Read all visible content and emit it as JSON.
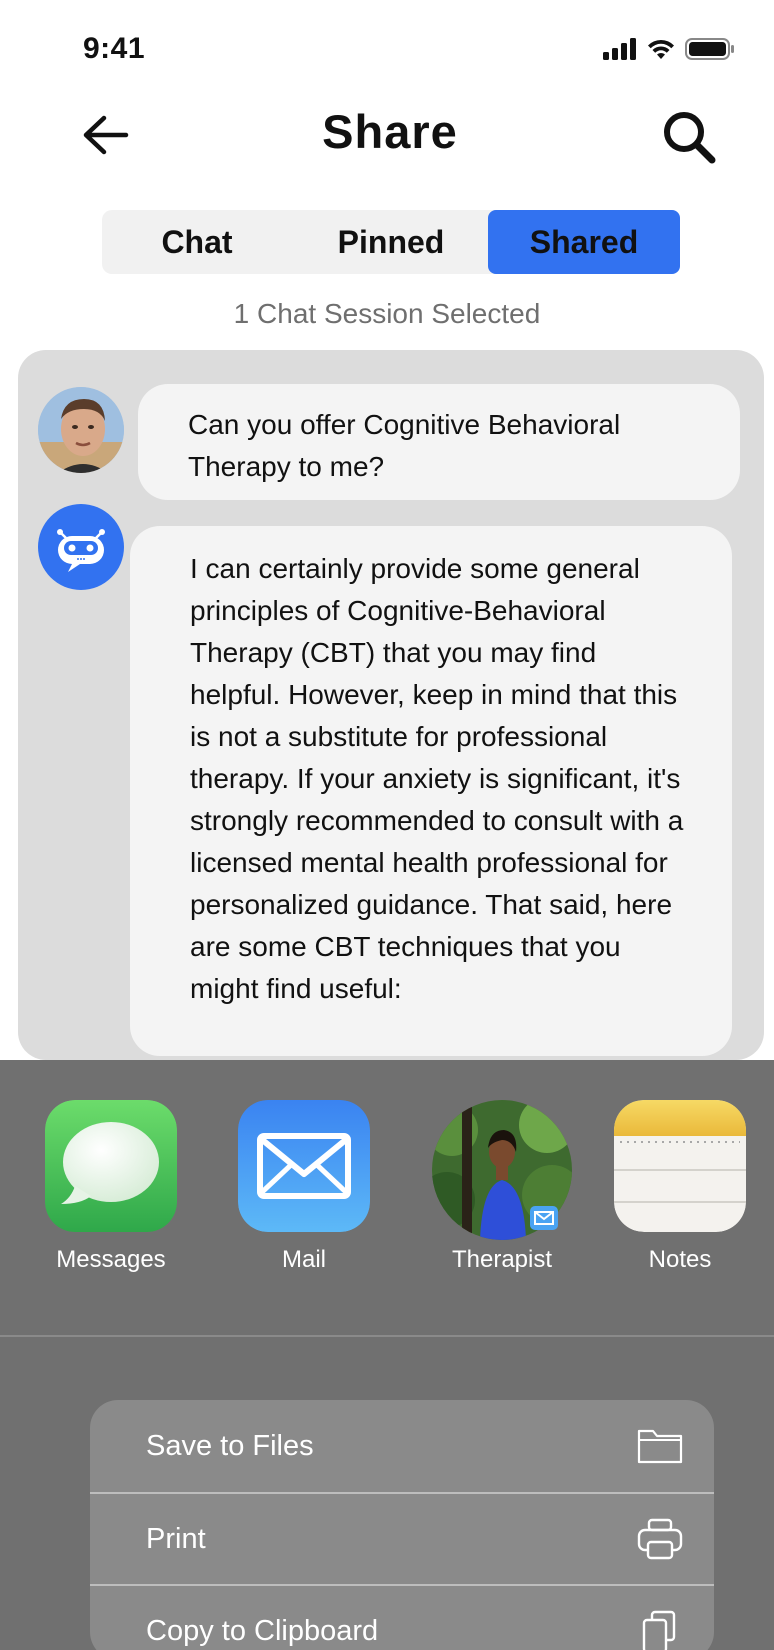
{
  "status_bar": {
    "time": "9:41"
  },
  "header": {
    "title": "Share"
  },
  "tabs": [
    {
      "label": "Chat",
      "active": false
    },
    {
      "label": "Pinned",
      "active": false
    },
    {
      "label": "Shared",
      "active": true
    }
  ],
  "selection": {
    "count_text": "1 Chat Session Selected"
  },
  "messages": [
    {
      "sender": "user",
      "text": "Can you offer Cognitive Behavioral Therapy to me?"
    },
    {
      "sender": "bot",
      "text": "I can certainly provide some general principles of Cognitive-Behavioral Therapy (CBT) that you may find helpful. However, keep in mind that this is not a substitute for professional therapy. If your anxiety is significant, it's strongly recommended to consult with a licensed mental health professional for personalized guidance. That said, here are some CBT techniques that you might find useful:"
    }
  ],
  "share_targets": [
    {
      "label": "Messages",
      "icon": "messages-app-icon"
    },
    {
      "label": "Mail",
      "icon": "mail-app-icon"
    },
    {
      "label": "Therapist",
      "icon": "contact-photo"
    },
    {
      "label": "Notes",
      "icon": "notes-app-icon"
    }
  ],
  "actions": [
    {
      "label": "Save to Files",
      "icon": "folder-icon"
    },
    {
      "label": "Print",
      "icon": "printer-icon"
    },
    {
      "label": "Copy to Clipboard",
      "icon": "copy-icon"
    }
  ],
  "colors": {
    "accent": "#3272f0",
    "sheet_background": "#707070",
    "panel_background": "#dcdcdc"
  }
}
